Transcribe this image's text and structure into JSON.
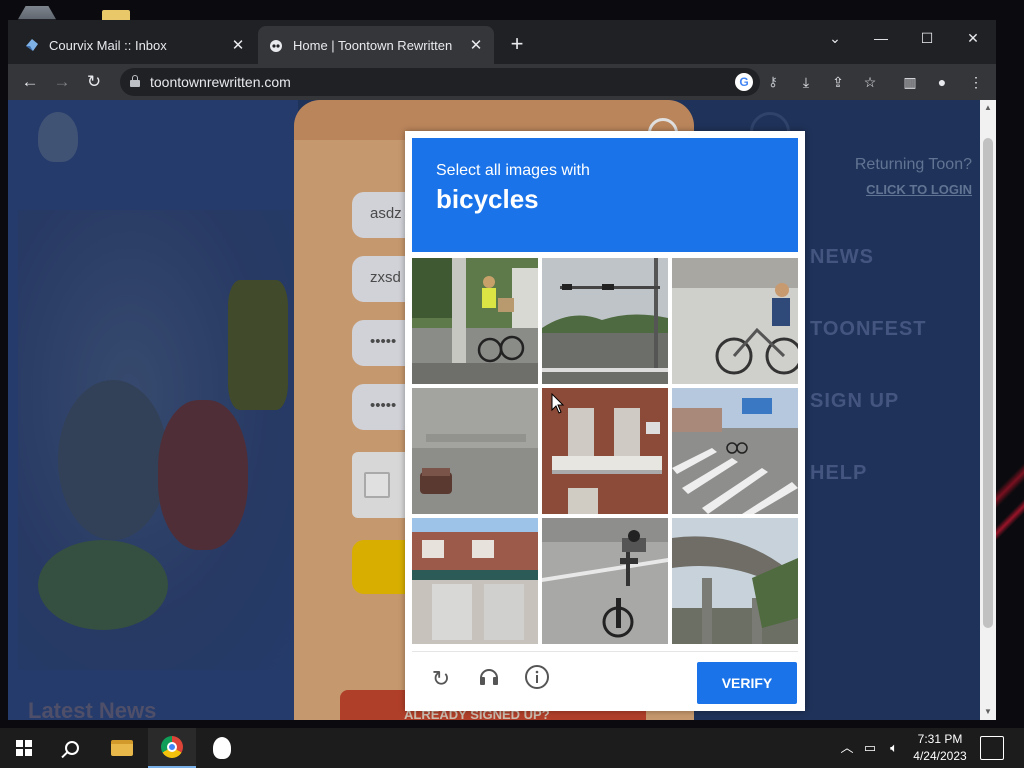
{
  "browser": {
    "tabs": [
      {
        "title": "Courvix Mail :: Inbox",
        "icon": "courvix-favicon",
        "active": false
      },
      {
        "title": "Home | Toontown Rewritten",
        "icon": "toontown-favicon",
        "active": true
      }
    ],
    "new_tab": "+",
    "url": "toontownrewritten.com"
  },
  "page": {
    "returning_text": "Returning Toon?",
    "login_link": "CLICK TO LOGIN",
    "nav": [
      "NEWS",
      "TOONFEST",
      "SIGN UP",
      "HELP"
    ],
    "latest_news": "Latest News",
    "signup_fields": [
      "asdz",
      "zxsd",
      "•••••",
      "•••••"
    ],
    "already_signed_up": "ALREADY SIGNED UP?"
  },
  "captcha": {
    "prompt": "Select all images with",
    "target": "bicycles",
    "verify_label": "VERIFY",
    "cells": [
      "cyclist-on-road",
      "traffic-light-intersection",
      "cyclist-in-park",
      "foggy-road-car",
      "apartment-balcony",
      "crosswalk-cyclists",
      "house-garage",
      "cyclist-from-behind",
      "highway-overpass"
    ]
  },
  "taskbar": {
    "time": "7:31 PM",
    "date": "4/24/2023"
  }
}
